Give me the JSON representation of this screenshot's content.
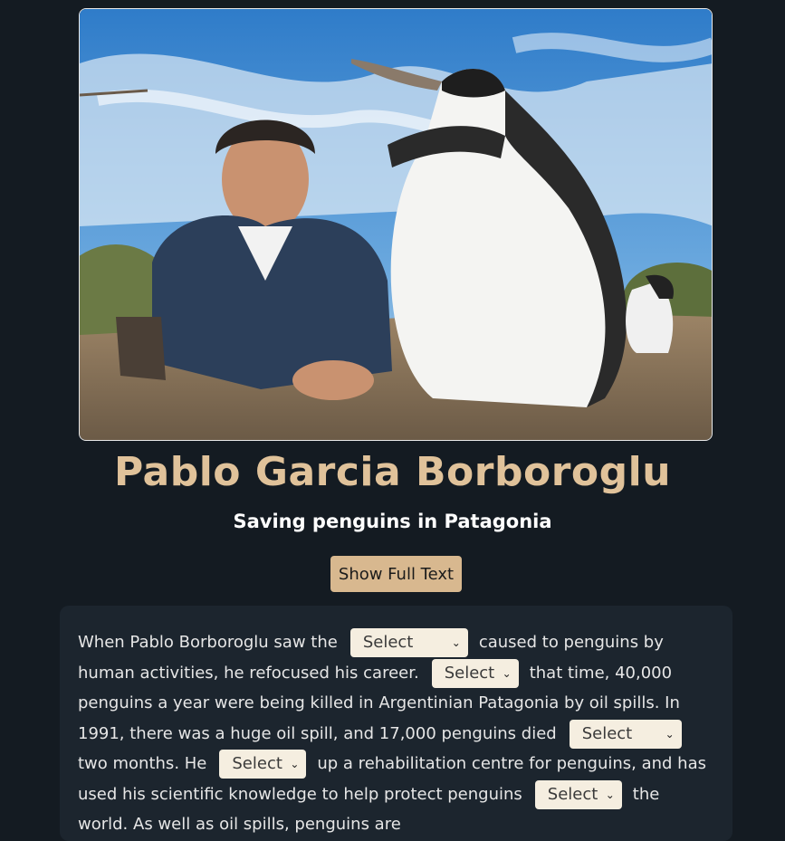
{
  "hero": {
    "image_icon_name": "photo-man-with-penguin"
  },
  "title": "Pablo Garcia Borboroglu",
  "subtitle": "Saving penguins in Patagonia",
  "show_full_text_label": "Show Full Text",
  "passage": {
    "t1": "When Pablo Borboroglu saw the",
    "t2": "caused to penguins by human activities, he refocused his career.",
    "t3": "that time, 40,000 penguins a year were being killed in Argentinian Patagonia by oil spills. In 1991, there was a huge oil spill, and 17,000 penguins died",
    "t4": "two months. He",
    "t5": "up a rehabilitation centre for penguins, and has used his scientific knowledge to help protect penguins",
    "t6": "the world. As well as oil spills, penguins are",
    "select_placeholder": "Select"
  },
  "colors": {
    "accent": "#e0c29a",
    "button": "#d8b88f",
    "background": "#141b22",
    "card": "#1c252e"
  }
}
